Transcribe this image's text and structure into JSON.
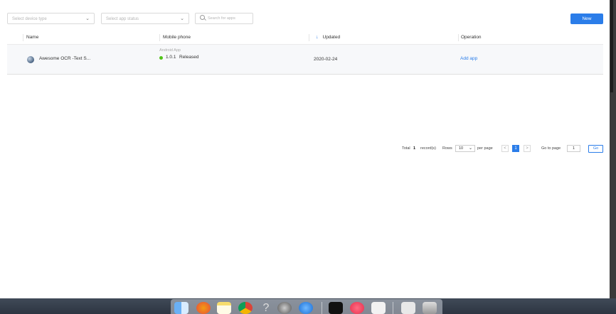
{
  "toolbar": {
    "device_type_placeholder": "Select device type",
    "app_status_placeholder": "Select app status",
    "search_placeholder": "Search for apps",
    "new_label": "New"
  },
  "table": {
    "columns": [
      "Name",
      "Mobile phone",
      "Updated",
      "Operation"
    ],
    "rows": [
      {
        "name": "Awesome OCR -Text S...",
        "platform": "Android App",
        "version": "1.0.1",
        "status": "Released",
        "updated": "2020-02-24",
        "operation": "Add app"
      }
    ]
  },
  "pagination": {
    "total_label": "Total",
    "total": "1",
    "records_label": "record(s)",
    "rows_label": "Rows",
    "rows_value": "10",
    "per_page_label": "per page",
    "prev": "<",
    "current_page": "1",
    "next": ">",
    "go_to_label": "Go to page",
    "go_to_value": "1",
    "go_label": "Go"
  },
  "colors": {
    "primary": "#2b7de9",
    "status_released": "#52c41a"
  },
  "dock": {
    "icons": [
      "finder-icon",
      "firefox-icon",
      "notes-icon",
      "chrome-icon",
      "help-icon",
      "system-preferences-icon",
      "app-store-icon",
      "terminal-icon",
      "music-icon",
      "preview-icon",
      "document-icon",
      "trash-icon"
    ]
  }
}
